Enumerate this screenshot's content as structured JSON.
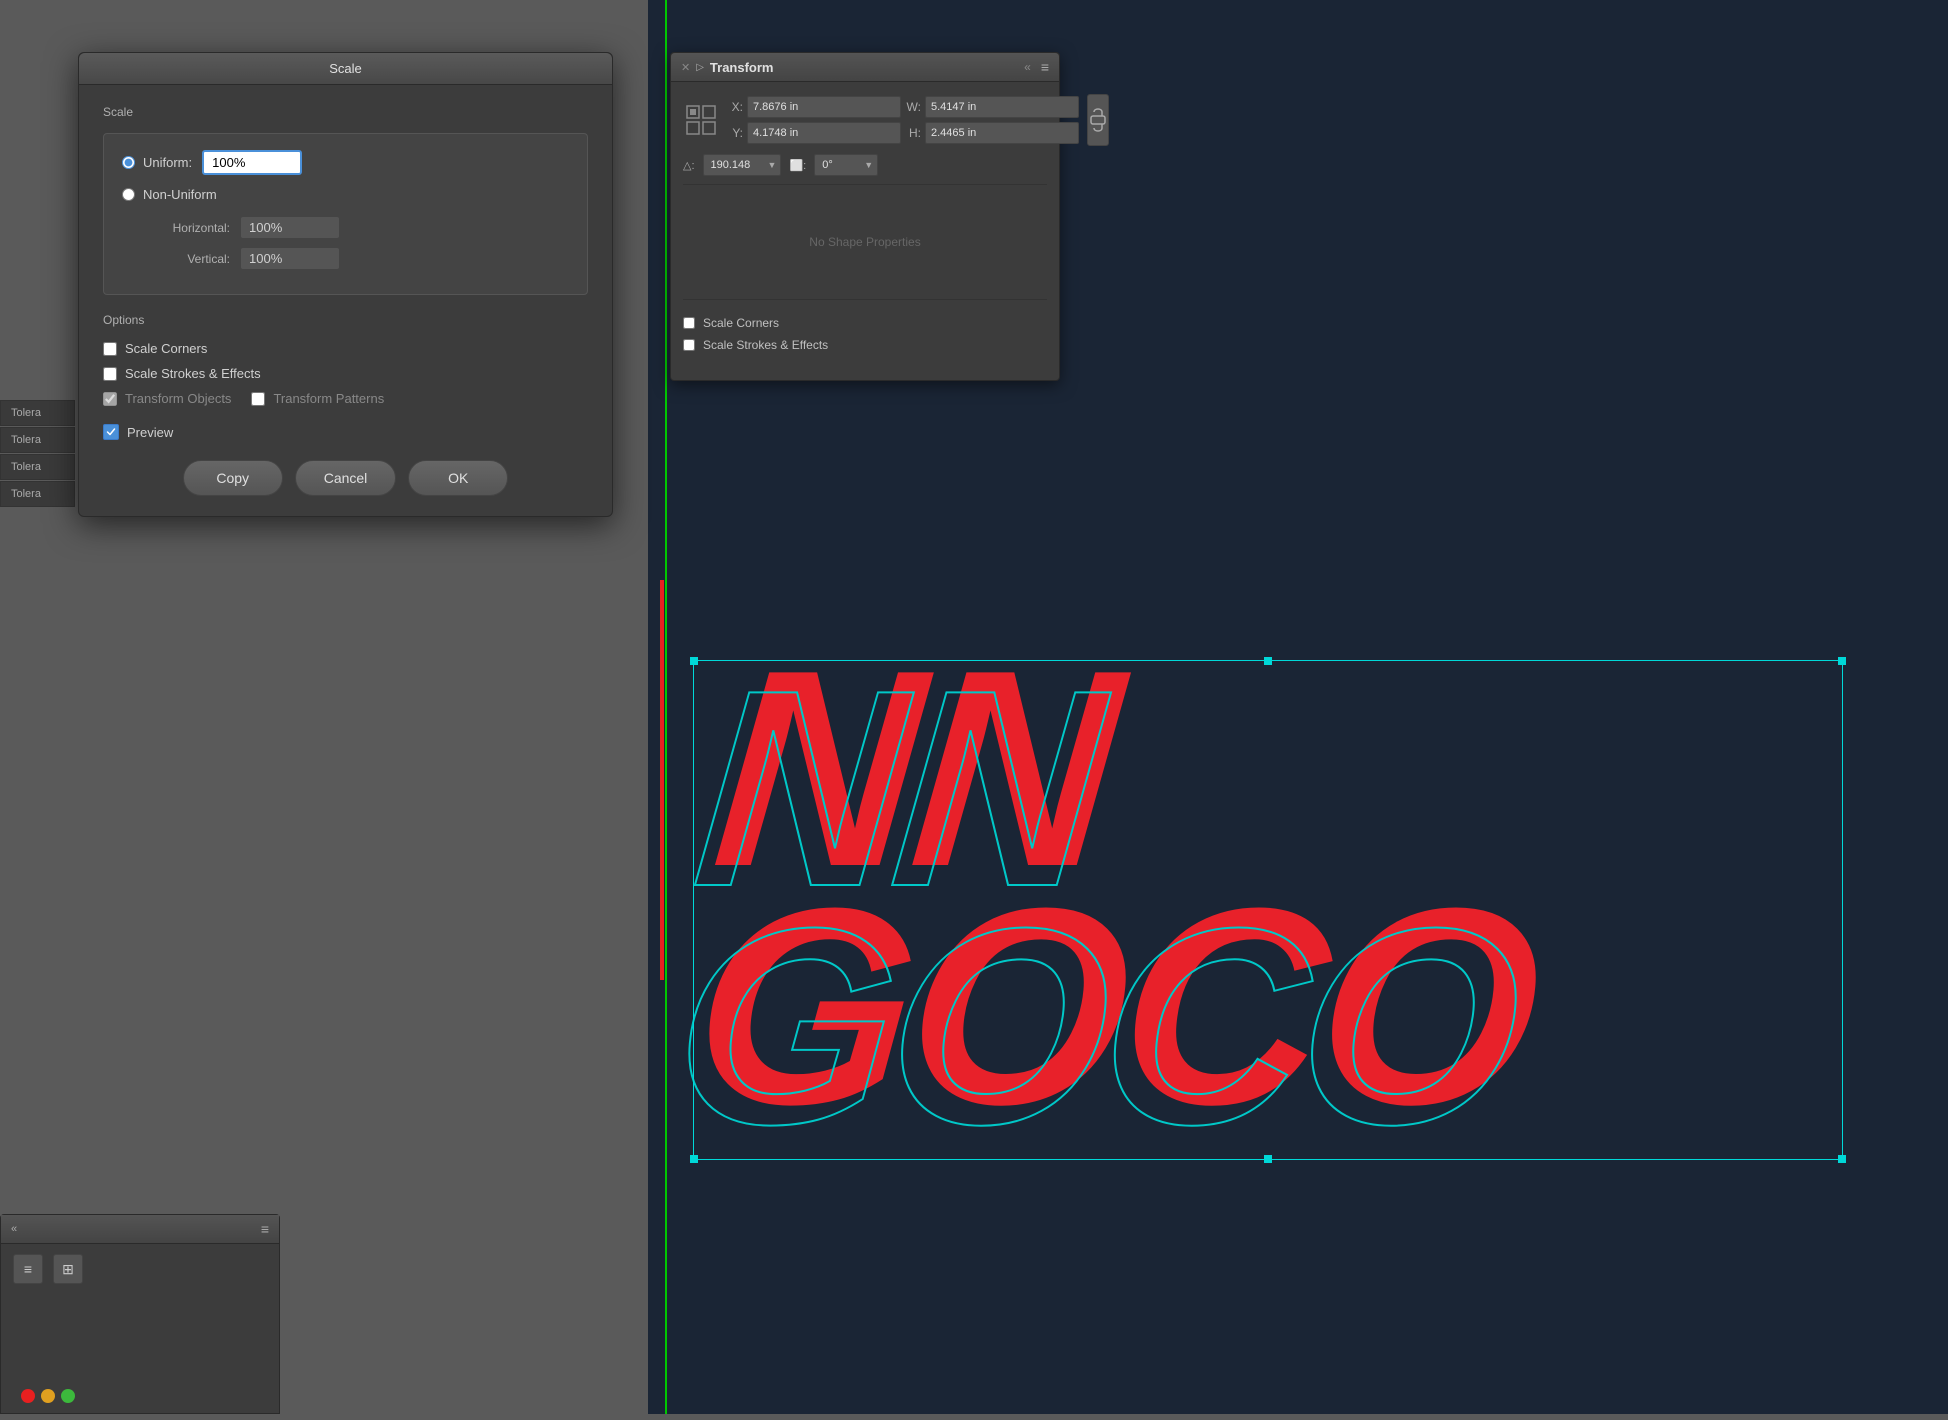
{
  "scale_dialog": {
    "title": "Scale",
    "scale_section_label": "Scale",
    "uniform_label": "Uniform:",
    "uniform_value": "100%",
    "non_uniform_label": "Non-Uniform",
    "horizontal_label": "Horizontal:",
    "horizontal_value": "100%",
    "vertical_label": "Vertical:",
    "vertical_value": "100%",
    "options_label": "Options",
    "scale_corners_label": "Scale Corners",
    "scale_strokes_label": "Scale Strokes & Effects",
    "transform_objects_label": "Transform Objects",
    "transform_patterns_label": "Transform Patterns",
    "preview_label": "Preview",
    "copy_btn": "Copy",
    "cancel_btn": "Cancel",
    "ok_btn": "OK"
  },
  "transform_panel": {
    "title": "Transform",
    "x_label": "X:",
    "x_value": "7.8676 in",
    "y_label": "Y:",
    "y_value": "4.1748 in",
    "w_label": "W:",
    "w_value": "5.4147 in",
    "h_label": "H:",
    "h_value": "2.4465 in",
    "angle_label": "190.148",
    "shear_label": "0°",
    "no_shape_props": "No Shape Properties",
    "scale_corners_label": "Scale Corners",
    "scale_strokes_label": "Scale Strokes & Effects"
  },
  "tolerance_items": [
    {
      "label": "Tolera"
    },
    {
      "label": "Tolera"
    },
    {
      "label": "Tolera"
    },
    {
      "label": "Tolera"
    }
  ],
  "bottom_panel": {
    "chevron": "«",
    "menu_icon": "≡"
  },
  "traffic_lights": {
    "green": "#3cb93c",
    "yellow": "#e0a020",
    "red": "#e82020"
  }
}
